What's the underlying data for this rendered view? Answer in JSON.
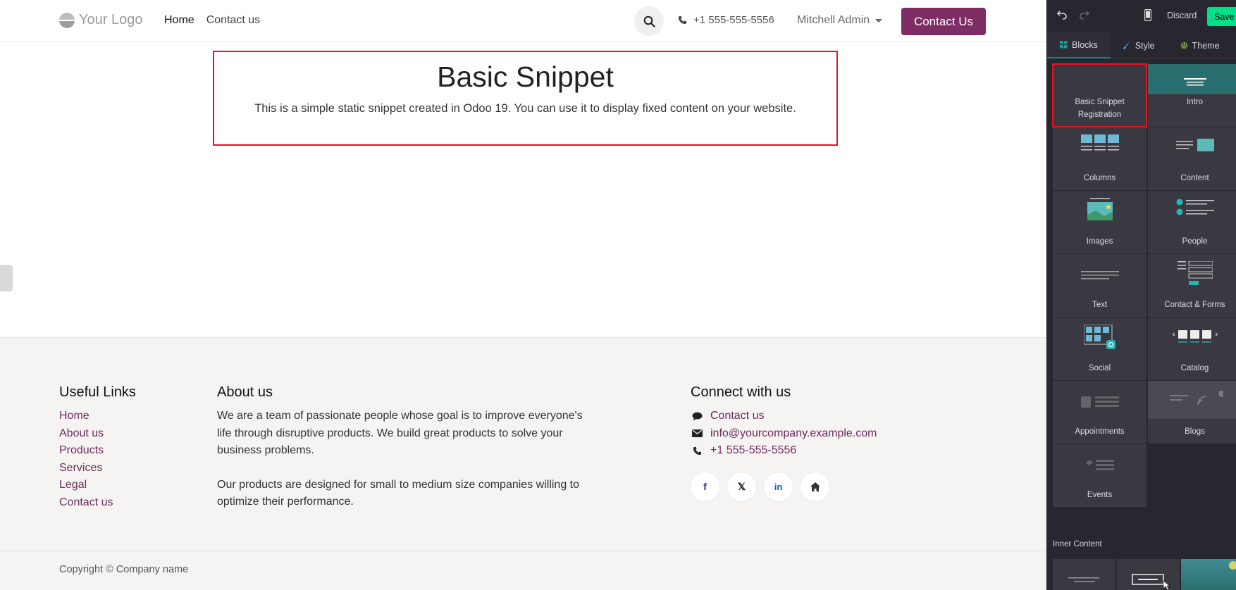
{
  "site": {
    "logo_text": "Your Logo",
    "nav": [
      {
        "label": "Home",
        "active": true
      },
      {
        "label": "Contact us",
        "active": false
      }
    ],
    "phone": "+1 555-555-5556",
    "user": "Mitchell Admin",
    "cta": "Contact Us"
  },
  "snippet": {
    "title": "Basic Snippet",
    "body": "This is a simple static snippet created in Odoo 19. You can use it to display fixed content on your website."
  },
  "footer": {
    "useful_links": {
      "heading": "Useful Links",
      "items": [
        "Home",
        "About us",
        "Products",
        "Services",
        "Legal",
        "Contact us"
      ]
    },
    "about": {
      "heading": "About us",
      "p1": "We are a team of passionate people whose goal is to improve everyone's life through disruptive products. We build great products to solve your business problems.",
      "p2": "Our products are designed for small to medium size companies willing to optimize their performance."
    },
    "connect": {
      "heading": "Connect with us",
      "contact": "Contact us",
      "email": "info@yourcompany.example.com",
      "phone": "+1 555-555-5556",
      "socials": [
        "facebook-icon",
        "x-icon",
        "linkedin-icon",
        "home-icon"
      ]
    },
    "copyright": "Copyright © Company name"
  },
  "panel": {
    "discard": "Discard",
    "save": "Save",
    "tabs": [
      "Blocks",
      "Style",
      "Theme"
    ],
    "blocks": [
      {
        "label": "Basic Snippet Registration"
      },
      {
        "label": "Intro"
      },
      {
        "label": "Columns"
      },
      {
        "label": "Content"
      },
      {
        "label": "Images"
      },
      {
        "label": "People"
      },
      {
        "label": "Text"
      },
      {
        "label": "Contact & Forms"
      },
      {
        "label": "Social"
      },
      {
        "label": "Catalog"
      },
      {
        "label": "Appointments"
      },
      {
        "label": "Blogs"
      },
      {
        "label": "Events"
      }
    ],
    "inner_content_title": "Inner Content"
  },
  "colors": {
    "brand": "#7e2c64",
    "link": "#6e2c5a",
    "panel_bg": "#28272f",
    "panel_tile": "#3a3941",
    "accent_teal": "#008f8c",
    "save_green": "#00e08a",
    "highlight_red": "#e8141c"
  }
}
